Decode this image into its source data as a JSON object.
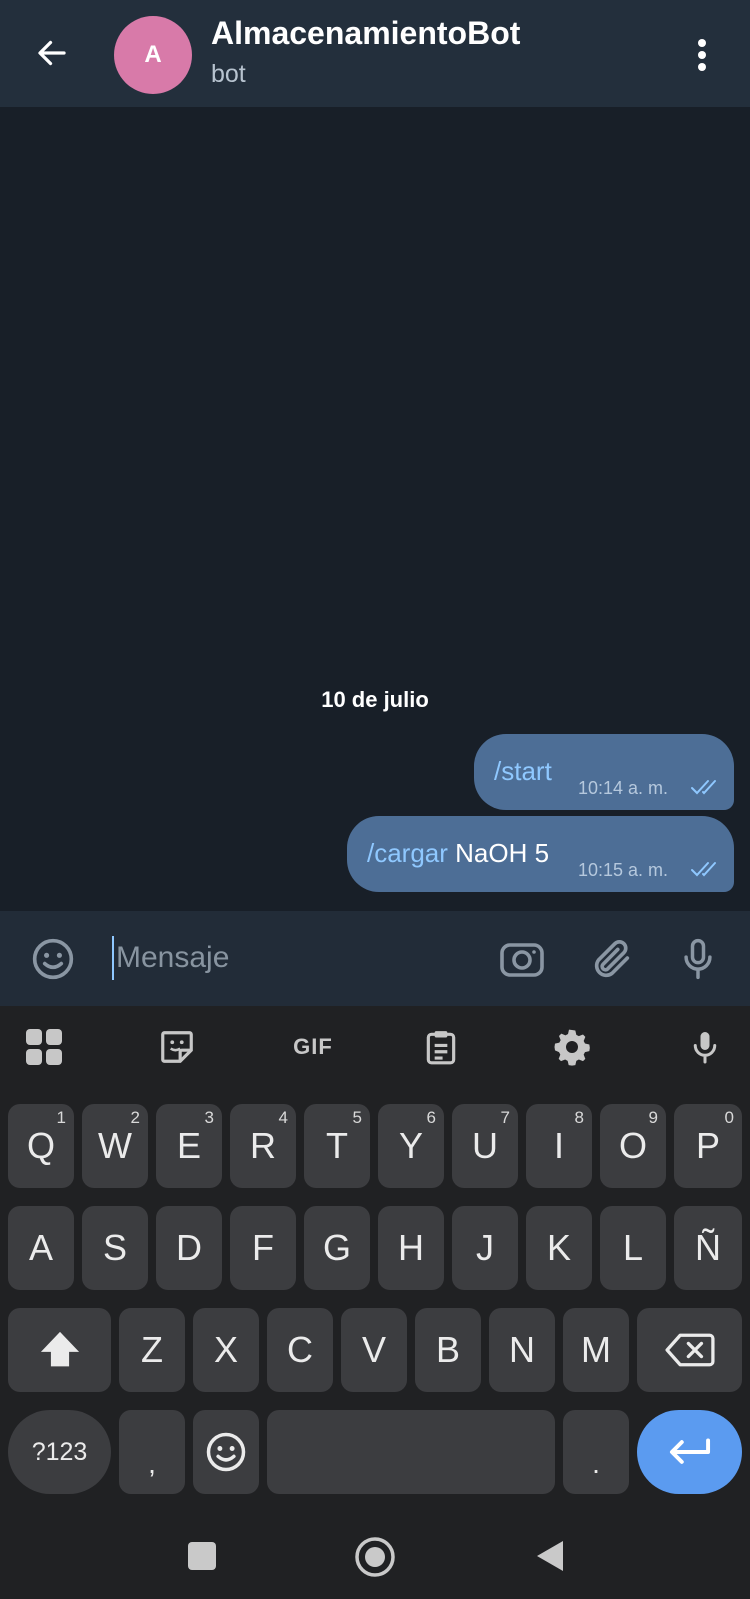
{
  "header": {
    "avatar_letter": "A",
    "title": "AlmacenamientoBot",
    "subtitle": "bot"
  },
  "chat": {
    "date_label": "10 de julio",
    "messages": [
      {
        "command": "/start",
        "text": "",
        "time": "10:14 a. m.",
        "status": "read"
      },
      {
        "command": "/cargar",
        "text": " NaOH 5",
        "time": "10:15 a. m.",
        "status": "read"
      }
    ]
  },
  "composer": {
    "placeholder": "Mensaje"
  },
  "keyboard": {
    "toolbar": {
      "gif_label": "GIF"
    },
    "row1": [
      {
        "label": "Q",
        "hint": "1"
      },
      {
        "label": "W",
        "hint": "2"
      },
      {
        "label": "E",
        "hint": "3"
      },
      {
        "label": "R",
        "hint": "4"
      },
      {
        "label": "T",
        "hint": "5"
      },
      {
        "label": "Y",
        "hint": "6"
      },
      {
        "label": "U",
        "hint": "7"
      },
      {
        "label": "I",
        "hint": "8"
      },
      {
        "label": "O",
        "hint": "9"
      },
      {
        "label": "P",
        "hint": "0"
      }
    ],
    "row2": [
      "A",
      "S",
      "D",
      "F",
      "G",
      "H",
      "J",
      "K",
      "L",
      "Ñ"
    ],
    "row3": [
      "Z",
      "X",
      "C",
      "V",
      "B",
      "N",
      "M"
    ],
    "bottom": {
      "symbols": "?123",
      "comma": ",",
      "period": "."
    }
  },
  "colors": {
    "header_bg": "#232f3c",
    "chat_bg": "#181f28",
    "bubble_out": "#4d6e96",
    "command_link": "#8fc8ff",
    "avatar": "#d87aa9",
    "enter_key": "#5b9bf0"
  }
}
